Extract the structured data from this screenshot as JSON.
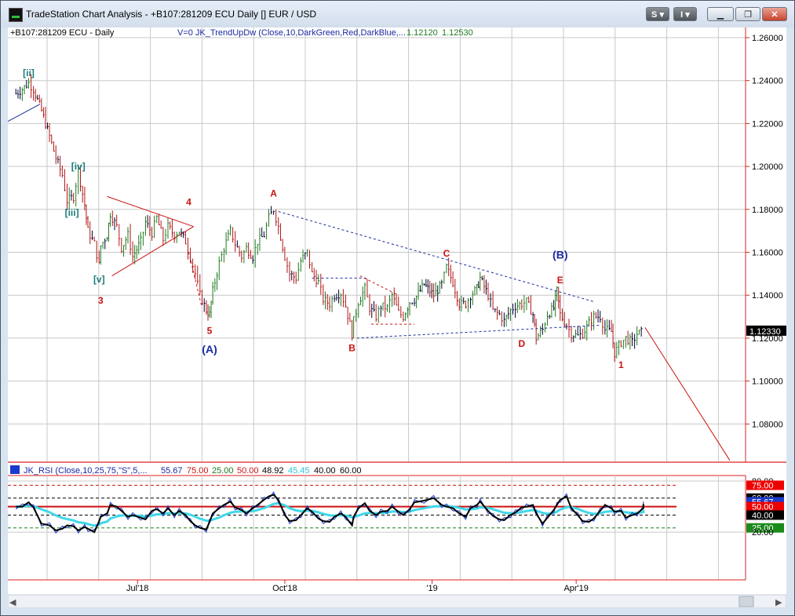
{
  "window": {
    "title": "TradeStation Chart Analysis - +B107:281209 ECU Daily [] EUR / USD",
    "btn_s": "S",
    "btn_i": "I"
  },
  "header": {
    "symbol": "+B107:281209 ECU - Daily",
    "indicator": "V=0  JK_TrendUpDw (Close,10,DarkGreen,Red,DarkBlue,...",
    "value1": "1.12120",
    "value2": "1.12530"
  },
  "rsi_header": {
    "label": "JK_RSI (Close,10,25,75,\"S\",5,...",
    "v1": "55.67",
    "v2": "75.00",
    "v3": "25.00",
    "v4": "50.00",
    "v5": "48.92",
    "v6": "45.45",
    "v7": "40.00",
    "v8": "60.00"
  },
  "colors": {
    "up": "#1f7a1f",
    "down": "#b01616",
    "neutral": "#000033",
    "annotation_red": "#cc1111",
    "annotation_blue": "#1a2aa0",
    "annotation_teal": "#1c7a7a",
    "rsi_cyan": "#3fd8e8",
    "rsi_blue": "#1a3acc"
  },
  "chart_data": [
    {
      "type": "candlestick",
      "title": "+B107:281209 ECU - Daily",
      "ylim": [
        1.06,
        1.265
      ],
      "yticks": [
        "1.26000",
        "1.24000",
        "1.22000",
        "1.20000",
        "1.18000",
        "1.16000",
        "1.14000",
        "1.12000",
        "1.10000",
        "1.08000"
      ],
      "ytick_values": [
        1.26,
        1.24,
        1.22,
        1.2,
        1.18,
        1.16,
        1.14,
        1.12,
        1.1,
        1.08
      ],
      "xticks": [
        "Jul'18",
        "Oct'18",
        "'19",
        "Apr'19"
      ],
      "last_price": "1.12330",
      "last_price_value": 1.1233,
      "series_close": [
        {
          "d": "2018-04-16",
          "c": 1.234
        },
        {
          "d": "2018-04-20",
          "c": 1.236
        },
        {
          "d": "2018-04-24",
          "c": 1.239
        },
        {
          "d": "2018-04-27",
          "c": 1.236
        },
        {
          "d": "2018-05-02",
          "c": 1.226
        },
        {
          "d": "2018-05-07",
          "c": 1.214
        },
        {
          "d": "2018-05-11",
          "c": 1.204
        },
        {
          "d": "2018-05-15",
          "c": 1.196
        },
        {
          "d": "2018-05-18",
          "c": 1.184
        },
        {
          "d": "2018-05-22",
          "c": 1.186
        },
        {
          "d": "2018-05-25",
          "c": 1.198
        },
        {
          "d": "2018-05-29",
          "c": 1.182
        },
        {
          "d": "2018-05-31",
          "c": 1.17
        },
        {
          "d": "2018-06-04",
          "c": 1.164
        },
        {
          "d": "2018-06-07",
          "c": 1.154
        },
        {
          "d": "2018-06-08",
          "c": 1.163
        },
        {
          "d": "2018-06-12",
          "c": 1.168
        },
        {
          "d": "2018-06-14",
          "c": 1.178
        },
        {
          "d": "2018-06-18",
          "c": 1.172
        },
        {
          "d": "2018-06-21",
          "c": 1.162
        },
        {
          "d": "2018-06-25",
          "c": 1.168
        },
        {
          "d": "2018-06-28",
          "c": 1.158
        },
        {
          "d": "2018-07-03",
          "c": 1.165
        },
        {
          "d": "2018-07-06",
          "c": 1.174
        },
        {
          "d": "2018-07-10",
          "c": 1.169
        },
        {
          "d": "2018-07-13",
          "c": 1.176
        },
        {
          "d": "2018-07-17",
          "c": 1.166
        },
        {
          "d": "2018-07-20",
          "c": 1.172
        },
        {
          "d": "2018-07-24",
          "c": 1.168
        },
        {
          "d": "2018-07-27",
          "c": 1.17
        },
        {
          "d": "2018-07-31",
          "c": 1.165
        },
        {
          "d": "2018-08-03",
          "c": 1.158
        },
        {
          "d": "2018-08-06",
          "c": 1.15
        },
        {
          "d": "2018-08-09",
          "c": 1.14
        },
        {
          "d": "2018-08-13",
          "c": 1.133
        },
        {
          "d": "2018-08-15",
          "c": 1.131
        },
        {
          "d": "2018-08-17",
          "c": 1.142
        },
        {
          "d": "2018-08-21",
          "c": 1.155
        },
        {
          "d": "2018-08-24",
          "c": 1.162
        },
        {
          "d": "2018-08-28",
          "c": 1.17
        },
        {
          "d": "2018-08-31",
          "c": 1.164
        },
        {
          "d": "2018-09-04",
          "c": 1.158
        },
        {
          "d": "2018-09-07",
          "c": 1.162
        },
        {
          "d": "2018-09-11",
          "c": 1.158
        },
        {
          "d": "2018-09-14",
          "c": 1.165
        },
        {
          "d": "2018-09-18",
          "c": 1.168
        },
        {
          "d": "2018-09-21",
          "c": 1.176
        },
        {
          "d": "2018-09-24",
          "c": 1.18
        },
        {
          "d": "2018-09-27",
          "c": 1.172
        },
        {
          "d": "2018-10-01",
          "c": 1.158
        },
        {
          "d": "2018-10-04",
          "c": 1.15
        },
        {
          "d": "2018-10-08",
          "c": 1.148
        },
        {
          "d": "2018-10-11",
          "c": 1.156
        },
        {
          "d": "2018-10-15",
          "c": 1.16
        },
        {
          "d": "2018-10-18",
          "c": 1.15
        },
        {
          "d": "2018-10-22",
          "c": 1.146
        },
        {
          "d": "2018-10-25",
          "c": 1.138
        },
        {
          "d": "2018-10-29",
          "c": 1.136
        },
        {
          "d": "2018-11-01",
          "c": 1.14
        },
        {
          "d": "2018-11-05",
          "c": 1.141
        },
        {
          "d": "2018-11-08",
          "c": 1.135
        },
        {
          "d": "2018-11-12",
          "c": 1.122
        },
        {
          "d": "2018-11-13",
          "c": 1.128
        },
        {
          "d": "2018-11-16",
          "c": 1.137
        },
        {
          "d": "2018-11-20",
          "c": 1.143
        },
        {
          "d": "2018-11-23",
          "c": 1.134
        },
        {
          "d": "2018-11-27",
          "c": 1.13
        },
        {
          "d": "2018-11-30",
          "c": 1.135
        },
        {
          "d": "2018-12-04",
          "c": 1.134
        },
        {
          "d": "2018-12-07",
          "c": 1.14
        },
        {
          "d": "2018-12-11",
          "c": 1.132
        },
        {
          "d": "2018-12-14",
          "c": 1.13
        },
        {
          "d": "2018-12-18",
          "c": 1.137
        },
        {
          "d": "2018-12-21",
          "c": 1.138
        },
        {
          "d": "2018-12-27",
          "c": 1.145
        },
        {
          "d": "2019-01-02",
          "c": 1.14
        },
        {
          "d": "2019-01-07",
          "c": 1.145
        },
        {
          "d": "2019-01-10",
          "c": 1.153
        },
        {
          "d": "2019-01-14",
          "c": 1.146
        },
        {
          "d": "2019-01-18",
          "c": 1.136
        },
        {
          "d": "2019-01-22",
          "c": 1.136
        },
        {
          "d": "2019-01-25",
          "c": 1.14
        },
        {
          "d": "2019-01-29",
          "c": 1.143
        },
        {
          "d": "2019-01-31",
          "c": 1.148
        },
        {
          "d": "2019-02-05",
          "c": 1.14
        },
        {
          "d": "2019-02-08",
          "c": 1.133
        },
        {
          "d": "2019-02-12",
          "c": 1.131
        },
        {
          "d": "2019-02-15",
          "c": 1.128
        },
        {
          "d": "2019-02-19",
          "c": 1.133
        },
        {
          "d": "2019-02-22",
          "c": 1.135
        },
        {
          "d": "2019-02-26",
          "c": 1.136
        },
        {
          "d": "2019-03-01",
          "c": 1.137
        },
        {
          "d": "2019-03-05",
          "c": 1.131
        },
        {
          "d": "2019-03-07",
          "c": 1.12
        },
        {
          "d": "2019-03-11",
          "c": 1.124
        },
        {
          "d": "2019-03-14",
          "c": 1.131
        },
        {
          "d": "2019-03-18",
          "c": 1.134
        },
        {
          "d": "2019-03-20",
          "c": 1.142
        },
        {
          "d": "2019-03-22",
          "c": 1.131
        },
        {
          "d": "2019-03-26",
          "c": 1.126
        },
        {
          "d": "2019-03-29",
          "c": 1.122
        },
        {
          "d": "2019-04-02",
          "c": 1.121
        },
        {
          "d": "2019-04-05",
          "c": 1.122
        },
        {
          "d": "2019-04-09",
          "c": 1.127
        },
        {
          "d": "2019-04-12",
          "c": 1.13
        },
        {
          "d": "2019-04-16",
          "c": 1.13
        },
        {
          "d": "2019-04-19",
          "c": 1.124
        },
        {
          "d": "2019-04-23",
          "c": 1.123
        },
        {
          "d": "2019-04-25",
          "c": 1.113
        },
        {
          "d": "2019-04-29",
          "c": 1.118
        },
        {
          "d": "2019-05-02",
          "c": 1.12
        },
        {
          "d": "2019-05-06",
          "c": 1.118
        },
        {
          "d": "2019-05-09",
          "c": 1.122
        },
        {
          "d": "2019-05-13",
          "c": 1.123
        }
      ],
      "annotations": [
        {
          "text": "[ii]",
          "d": "2018-04-24",
          "price": 1.242,
          "color": "teal"
        },
        {
          "text": "[iv]",
          "d": "2018-05-25",
          "price": 1.1985,
          "color": "teal"
        },
        {
          "text": "[iii]",
          "d": "2018-05-21",
          "price": 1.177,
          "color": "teal"
        },
        {
          "text": "[v]",
          "d": "2018-06-07",
          "price": 1.146,
          "color": "teal"
        },
        {
          "text": "3",
          "d": "2018-06-08",
          "price": 1.136,
          "color": "red"
        },
        {
          "text": "4",
          "d": "2018-08-02",
          "price": 1.182,
          "color": "red"
        },
        {
          "text": "5",
          "d": "2018-08-15",
          "price": 1.122,
          "color": "red"
        },
        {
          "text": "(A)",
          "d": "2018-08-15",
          "price": 1.113,
          "color": "blue"
        },
        {
          "text": "A",
          "d": "2018-09-24",
          "price": 1.186,
          "color": "red"
        },
        {
          "text": "B",
          "d": "2018-11-12",
          "price": 1.114,
          "color": "red"
        },
        {
          "text": "C",
          "d": "2019-01-10",
          "price": 1.158,
          "color": "red"
        },
        {
          "text": "D",
          "d": "2019-02-26",
          "price": 1.116,
          "color": "red"
        },
        {
          "text": "(B)",
          "d": "2019-03-22",
          "price": 1.157,
          "color": "blue"
        },
        {
          "text": "E",
          "d": "2019-03-22",
          "price": 1.1455,
          "color": "red"
        },
        {
          "text": "1",
          "d": "2019-04-29",
          "price": 1.106,
          "color": "red"
        }
      ],
      "trendlines": [
        {
          "from": {
            "d": "2018-04-11",
            "price": 1.221
          },
          "to": {
            "d": "2018-05-01",
            "price": 1.229
          },
          "color": "blue",
          "style": "solid"
        },
        {
          "from": {
            "d": "2018-06-12",
            "price": 1.186
          },
          "to": {
            "d": "2018-08-05",
            "price": 1.172
          },
          "color": "red",
          "style": "solid"
        },
        {
          "from": {
            "d": "2018-06-15",
            "price": 1.149
          },
          "to": {
            "d": "2018-08-05",
            "price": 1.172
          },
          "color": "red",
          "style": "solid"
        },
        {
          "from": {
            "d": "2018-08-02",
            "price": 1.16
          },
          "to": {
            "d": "2018-08-10",
            "price": 1.135
          },
          "color": "red",
          "style": "dash"
        },
        {
          "from": {
            "d": "2018-09-27",
            "price": 1.179
          },
          "to": {
            "d": "2019-04-12",
            "price": 1.137
          },
          "color": "blue",
          "style": "dash"
        },
        {
          "from": {
            "d": "2018-11-15",
            "price": 1.12
          },
          "to": {
            "d": "2019-04-16",
            "price": 1.126
          },
          "color": "blue",
          "style": "dash"
        },
        {
          "from": {
            "d": "2018-10-18",
            "price": 1.148
          },
          "to": {
            "d": "2018-11-22",
            "price": 1.148
          },
          "color": "blue",
          "style": "dash"
        },
        {
          "from": {
            "d": "2018-11-17",
            "price": 1.149
          },
          "to": {
            "d": "2018-12-11",
            "price": 1.14
          },
          "color": "red",
          "style": "dash"
        },
        {
          "from": {
            "d": "2018-11-24",
            "price": 1.1265
          },
          "to": {
            "d": "2018-12-21",
            "price": 1.1265
          },
          "color": "red",
          "style": "dash"
        },
        {
          "from": {
            "d": "2019-05-14",
            "price": 1.125
          },
          "to": {
            "d": "2019-07-06",
            "price": 1.063
          },
          "color": "red",
          "style": "solid"
        }
      ]
    },
    {
      "type": "line",
      "title": "JK_RSI (Close,10,25,75,\"S\",5,...",
      "ylim": [
        5,
        85
      ],
      "yticks": [
        "80.00",
        "75.00",
        "60.00",
        "55.67",
        "50.00",
        "40.00",
        "25.00",
        "20.00"
      ],
      "ytick_values": [
        80,
        75,
        60,
        55.67,
        50,
        40,
        25,
        20
      ],
      "levels": [
        {
          "value": 75,
          "color": "red",
          "style": "dash"
        },
        {
          "value": 60,
          "color": "black",
          "style": "dash"
        },
        {
          "value": 50,
          "color": "red",
          "style": "solid"
        },
        {
          "value": 40,
          "color": "black",
          "style": "dash"
        },
        {
          "value": 25,
          "color": "green",
          "style": "dash"
        }
      ],
      "series": [
        {
          "name": "JK_RSI",
          "values": [
            50,
            50,
            55,
            49,
            30,
            28,
            22,
            24,
            28,
            27,
            22,
            26,
            24,
            20,
            33,
            38,
            42,
            52,
            50,
            45,
            38,
            40,
            37,
            35,
            45,
            47,
            42,
            48,
            40,
            45,
            40,
            33,
            28,
            25,
            23,
            32,
            42,
            48,
            52,
            56,
            49,
            46,
            42,
            48,
            52,
            58,
            62,
            64,
            58,
            40,
            33,
            34,
            40,
            48,
            44,
            36,
            33,
            32,
            38,
            42,
            38,
            28,
            38,
            48,
            54,
            45,
            40,
            44,
            45,
            50,
            44,
            40,
            47,
            55,
            57,
            60,
            52,
            50,
            48,
            42,
            38,
            48,
            52,
            56,
            45,
            39,
            35,
            34,
            40,
            43,
            49,
            50,
            52,
            42,
            30,
            37,
            46,
            52,
            58,
            62,
            48,
            40,
            33,
            32,
            36,
            45,
            52,
            48,
            44,
            45,
            37,
            40,
            42,
            48,
            50,
            53
          ]
        }
      ]
    }
  ]
}
